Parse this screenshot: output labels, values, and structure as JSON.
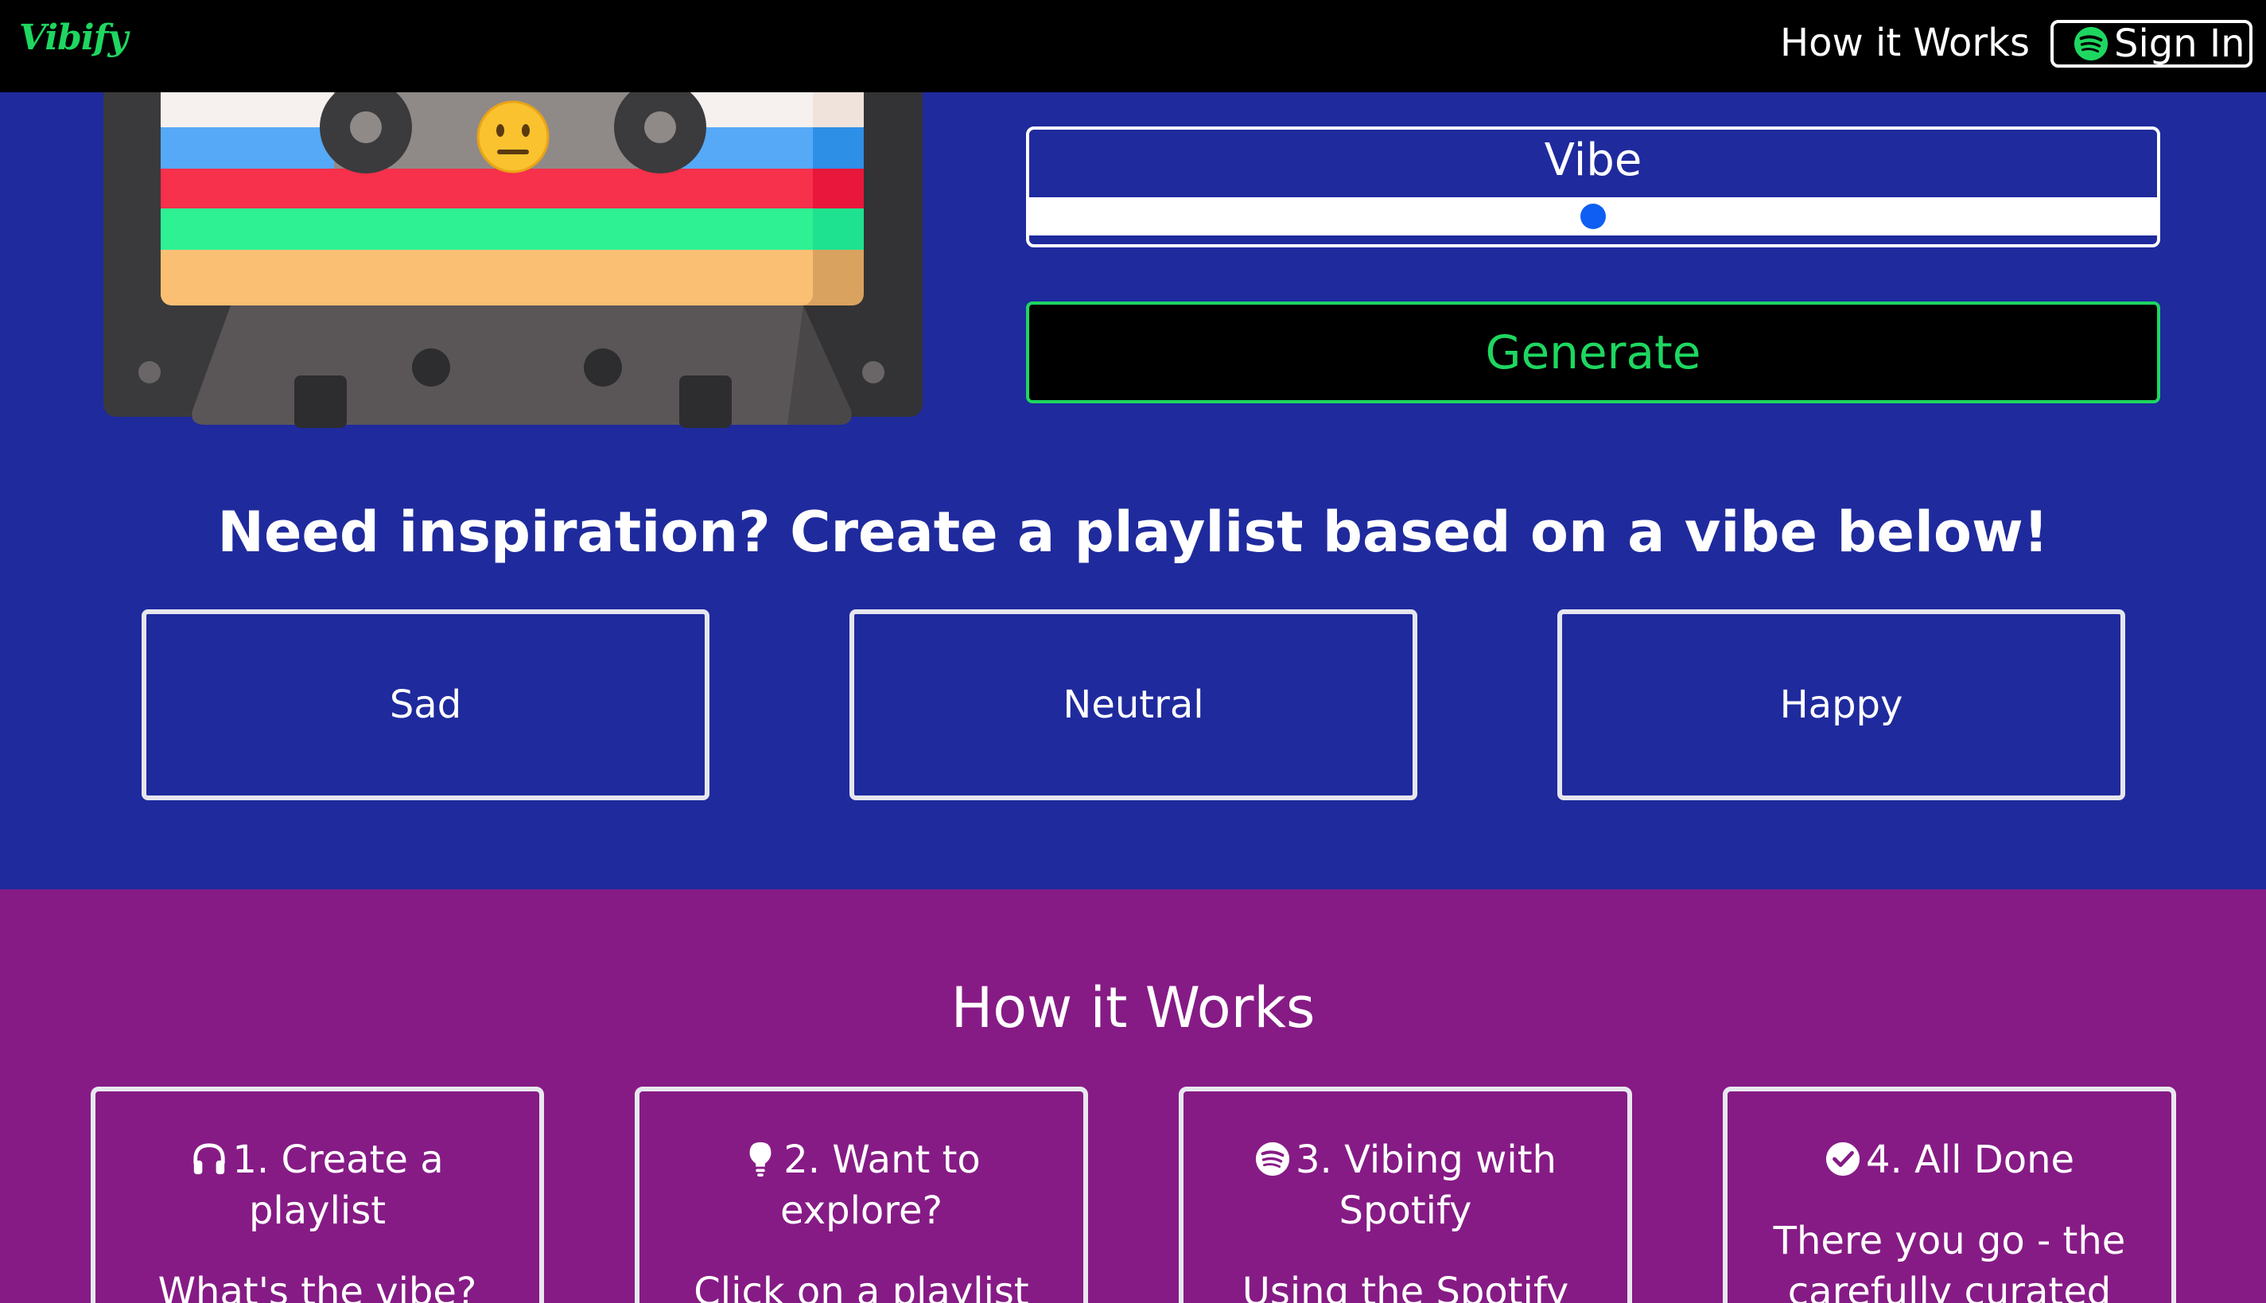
{
  "brand": "Vibify",
  "nav": {
    "how_it_works": "How it Works",
    "sign_in": "Sign In"
  },
  "player": {
    "emoji": "😐",
    "vibe_label": "Vibe",
    "vibe_value_fraction": 0.5,
    "generate_label": "Generate"
  },
  "inspiration": {
    "heading": "Need inspiration? Create a playlist based on a vibe below!",
    "moods": [
      "Sad",
      "Neutral",
      "Happy"
    ]
  },
  "how_it_works": {
    "title": "How it Works",
    "cards": [
      {
        "icon": "headphones-icon",
        "title": "1. Create a playlist",
        "body": "What's the vibe?"
      },
      {
        "icon": "lightbulb-icon",
        "title": "2. Want to explore?",
        "body": "Click on a playlist"
      },
      {
        "icon": "spotify-icon",
        "title": "3. Vibing with Spotify",
        "body": "Using the Spotify"
      },
      {
        "icon": "check-circle-icon",
        "title": "4. All Done",
        "body": "There you go - the carefully curated"
      }
    ]
  },
  "colors": {
    "primary_bg": "#1f2a9d",
    "secondary_bg": "#861b85",
    "accent_green": "#1ed760",
    "slider_thumb": "#0e5ef3"
  }
}
